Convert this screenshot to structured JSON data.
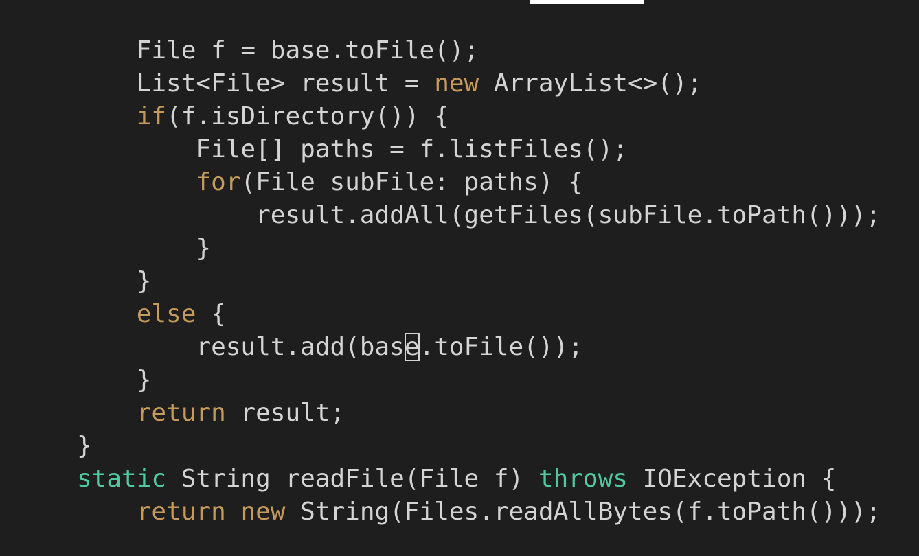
{
  "colors": {
    "background": "#1e1e1e",
    "text": "#d4d4d4",
    "keyword": "#c69a5a",
    "modifier_keyword": "#4ec9a0"
  },
  "lines": [
    {
      "indent": 1,
      "tokens": [
        {
          "t": "File f = base.toFile();",
          "k": "plain"
        }
      ]
    },
    {
      "indent": 1,
      "tokens": [
        {
          "t": "List<File> result = ",
          "k": "plain"
        },
        {
          "t": "new",
          "k": "kw"
        },
        {
          "t": " ArrayList<>();",
          "k": "plain"
        }
      ]
    },
    {
      "indent": 1,
      "tokens": [
        {
          "t": "if",
          "k": "kw"
        },
        {
          "t": "(f.isDirectory()) {",
          "k": "plain"
        }
      ]
    },
    {
      "indent": 2,
      "tokens": [
        {
          "t": "File[] paths = f.listFiles();",
          "k": "plain"
        }
      ]
    },
    {
      "indent": 2,
      "tokens": [
        {
          "t": "for",
          "k": "kw"
        },
        {
          "t": "(File subFile: paths) {",
          "k": "plain"
        }
      ]
    },
    {
      "indent": 3,
      "tokens": [
        {
          "t": "result.addAll(getFiles(subFile.toPath()));",
          "k": "plain"
        }
      ]
    },
    {
      "indent": 2,
      "tokens": [
        {
          "t": "}",
          "k": "plain"
        }
      ]
    },
    {
      "indent": 1,
      "tokens": [
        {
          "t": "}",
          "k": "plain"
        }
      ]
    },
    {
      "indent": 1,
      "tokens": [
        {
          "t": "else",
          "k": "kw"
        },
        {
          "t": " {",
          "k": "plain"
        }
      ]
    },
    {
      "indent": 2,
      "tokens": [
        {
          "t": "result.add(bas",
          "k": "plain"
        },
        {
          "t": "e",
          "k": "cursor"
        },
        {
          "t": ".toFile());",
          "k": "plain"
        }
      ]
    },
    {
      "indent": 1,
      "tokens": [
        {
          "t": "}",
          "k": "plain"
        }
      ]
    },
    {
      "indent": 1,
      "tokens": [
        {
          "t": "return",
          "k": "kw"
        },
        {
          "t": " result;",
          "k": "plain"
        }
      ]
    },
    {
      "indent": 0,
      "tokens": [
        {
          "t": "}",
          "k": "plain"
        }
      ]
    },
    {
      "indent": 0,
      "tokens": [
        {
          "t": "static",
          "k": "kw2"
        },
        {
          "t": " String readFile(File f) ",
          "k": "plain"
        },
        {
          "t": "throws",
          "k": "kw2"
        },
        {
          "t": " IOException {",
          "k": "plain"
        }
      ]
    },
    {
      "indent": 1,
      "tokens": [
        {
          "t": "return",
          "k": "kw"
        },
        {
          "t": " ",
          "k": "plain"
        },
        {
          "t": "new",
          "k": "kw"
        },
        {
          "t": " String(Files.readAllBytes(f.toPath()));",
          "k": "plain"
        }
      ]
    }
  ]
}
